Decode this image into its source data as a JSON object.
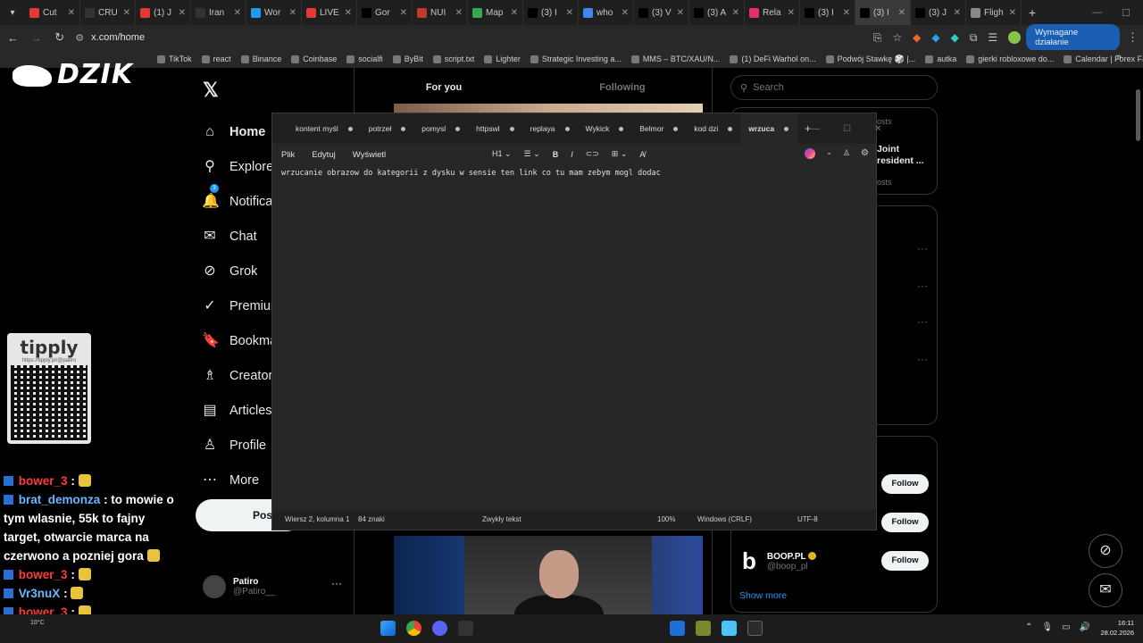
{
  "browser": {
    "tabs": [
      {
        "label": "Cut",
        "fav_color": "#e53935"
      },
      {
        "label": "CRU",
        "fav_color": "#333333"
      },
      {
        "label": "(1) J",
        "fav_color": "#e53935"
      },
      {
        "label": "Iran",
        "fav_color": "#333333"
      },
      {
        "label": "Wor",
        "fav_color": "#1d9bf0"
      },
      {
        "label": "LIVE",
        "fav_color": "#e53935"
      },
      {
        "label": "Gor",
        "fav_color": "#000000"
      },
      {
        "label": "NUI",
        "fav_color": "#c0392b"
      },
      {
        "label": "Map",
        "fav_color": "#34a853"
      },
      {
        "label": "(3) I",
        "fav_color": "#000000"
      },
      {
        "label": "who",
        "fav_color": "#4285f4"
      },
      {
        "label": "(3) V",
        "fav_color": "#000000"
      },
      {
        "label": "(3) A",
        "fav_color": "#000000"
      },
      {
        "label": "Rela",
        "fav_color": "#e1306c"
      },
      {
        "label": "(3) I",
        "fav_color": "#000000"
      },
      {
        "label": "(3) I",
        "fav_color": "#000000"
      },
      {
        "label": "(3) J",
        "fav_color": "#000000"
      },
      {
        "label": "Fligh",
        "fav_color": "#888888"
      }
    ],
    "active_tab_index": 15,
    "url": "x.com/home",
    "action_button": "Wymagane działanie",
    "bookmarks": [
      "TikTok",
      "react",
      "Binance",
      "Coinbase",
      "socialfi",
      "ByBit",
      "script.txt",
      "Lighter",
      "Strategic Investing a...",
      "MMS – BTC/XAU/N...",
      "(1) DeFi Warhol on...",
      "Podwój Stawkę 🎲 |...",
      "autka",
      "gierki robloxowe do...",
      "Calendar | Forex Fac..."
    ]
  },
  "overlay": {
    "brand": "DZIK",
    "tipply_name": "tipply",
    "tipply_url": "https://tipply.pl/@patiro",
    "chat": [
      {
        "user": "bower_3",
        "color": "red",
        "text": ":"
      },
      {
        "user": "brat_demonza",
        "color": "blue",
        "text": ": to mowie o tym wlasnie, 55k to fajny target, otwarcie marca na czerwono a pozniej gora"
      },
      {
        "user": "bower_3",
        "color": "red",
        "text": ":"
      },
      {
        "user": "Vr3nuX",
        "color": "blue",
        "text": ":"
      },
      {
        "user": "bower_3",
        "color": "red",
        "text": ":"
      }
    ]
  },
  "x": {
    "nav": [
      "Home",
      "Explore",
      "Notifications",
      "Chat",
      "Grok",
      "Premium",
      "Bookmarks",
      "Creator Studio",
      "Articles",
      "Profile",
      "More"
    ],
    "notif_count": "3",
    "post_label": "Post",
    "account": {
      "name": "Patiro",
      "handle": "@Patiro__"
    },
    "tabs": {
      "for_you": "For you",
      "following": "Following"
    },
    "search_placeholder": "Search",
    "card1": {
      "a": "osts",
      "b": "Joint\nresident ...",
      "c": "osts"
    },
    "follow_label": "Follow",
    "boop": {
      "name": "BOOP.PL",
      "handle": "@boop_pl"
    },
    "show_more": "Show more"
  },
  "notepad": {
    "tabs": [
      "kontent myśl",
      "potrzeł",
      "pomysl",
      "httpswl",
      "replaya",
      "Wykick",
      "Belmor",
      "kod dzi",
      "wrzuca"
    ],
    "active_tab_index": 8,
    "menu": [
      "Plik",
      "Edytuj",
      "Wyświetl"
    ],
    "heading_select": "H1",
    "content": "wrzucanie obrazow do kategorii z dysku w sensie ten link co tu mam zebym mogl dodac",
    "status": {
      "position": "Wiersz 2, kolumna 1",
      "chars": "84 znaki",
      "format": "Zwykły tekst",
      "zoom": "100%",
      "eol": "Windows (CRLF)",
      "encoding": "UTF-8"
    }
  },
  "taskbar": {
    "weather": "10°C",
    "time": "16:11",
    "date": "28.02.2026"
  }
}
